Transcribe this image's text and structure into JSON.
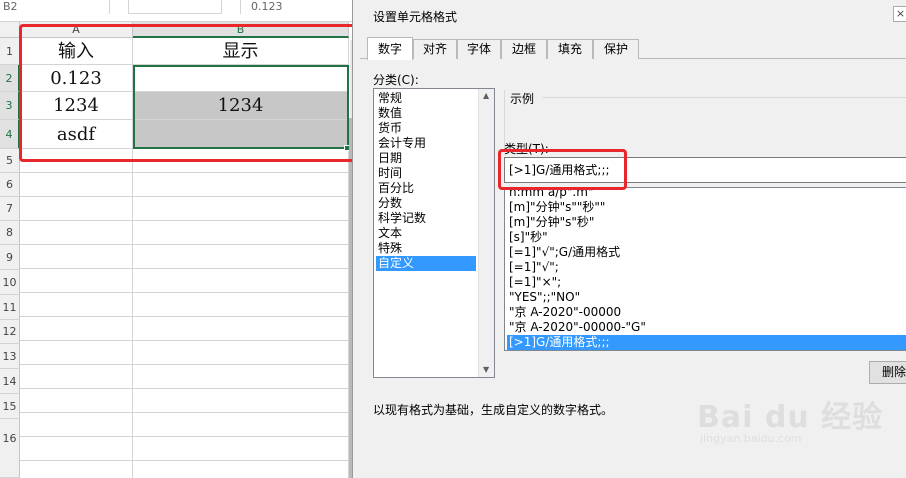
{
  "formula_bar": {
    "name_box": "B2",
    "value": "0.123"
  },
  "sheet": {
    "columns": [
      "A",
      "B"
    ],
    "rows": [
      "1",
      "2",
      "3",
      "4",
      "5",
      "6",
      "7",
      "8",
      "9",
      "10",
      "11",
      "12",
      "13",
      "14",
      "15",
      "16"
    ],
    "cells": {
      "A1": "输入",
      "B1": "显示",
      "A2": "0.123",
      "B2": "",
      "A3": "1234",
      "B3": "1234",
      "A4": "asdf",
      "B4": ""
    }
  },
  "dialog": {
    "title": "设置单元格格式",
    "close_label": "×",
    "tabs": [
      "数字",
      "对齐",
      "字体",
      "边框",
      "填充",
      "保护"
    ],
    "active_tab": "数字",
    "category_label": "分类(C):",
    "categories": [
      "常规",
      "数值",
      "货币",
      "会计专用",
      "日期",
      "时间",
      "百分比",
      "分数",
      "科学记数",
      "文本",
      "特殊",
      "自定义"
    ],
    "selected_category": "自定义",
    "sample_label": "示例",
    "type_label": "类型(T):",
    "type_value": "[>1]G/通用格式;;;",
    "format_list": [
      "h:mm a/p\".m\"",
      "[m]\"分钟\"s\"\"秒\"\"",
      "[m]\"分钟\"s\"秒\"",
      "[s]\"秒\"",
      "[=1]\"√\";G/通用格式",
      "[=1]\"√\";",
      "[=1]\"×\";",
      "\"YES\";;\"NO\"",
      "\"京 A-2020\"-00000",
      "\"京 A-2020\"-00000-\"G\"",
      "[>1]G/通用格式;;;"
    ],
    "selected_format": "[>1]G/通用格式;;;",
    "delete_button": "删除",
    "hint": "以现有格式为基础，生成自定义的数字格式。"
  },
  "watermark": {
    "main": "Bai du 经验",
    "sub": "jingyan.baidu.com"
  },
  "colors": {
    "excel_green": "#217346",
    "highlight_red": "#e8272d",
    "selection_blue": "#3399ff",
    "gray_fill": "#c7c7c7"
  }
}
